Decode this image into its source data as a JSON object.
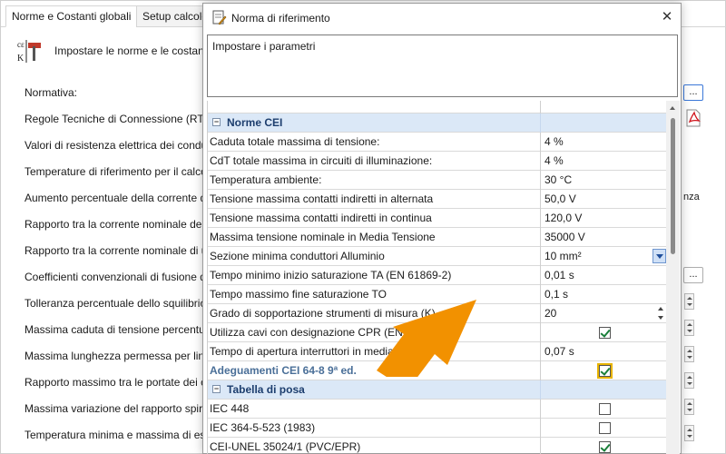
{
  "background": {
    "tabs": [
      "Norme e Costanti globali",
      "Setup calcolo"
    ],
    "header_text": "Impostare le norme e le costanti",
    "labels": [
      "Normativa:",
      "Regole Tecniche di Connessione (RTC):",
      "Valori di resistenza elettrica dei condutt",
      "Temperature di riferimento per il calcolo",
      "Aumento percentuale della corrente di",
      "Rapporto tra la corrente nominale dell",
      "Rapporto tra la corrente nominale di u",
      "Coefficienti convenzionali di fusione d",
      "Tolleranza percentuale dello squilibrio",
      "Massima caduta di tensione percentua",
      "Massima lunghezza permessa per line",
      "Rapporto massimo tra le portate dei c",
      "Massima variazione del rapporto spire",
      "Temperatura minima e massima di ese"
    ],
    "right_text": "nza",
    "dots_label": "..."
  },
  "dialog": {
    "title": "Norma di riferimento",
    "close_label": "✕",
    "description": "Impostare i parametri",
    "categories": {
      "norme": "Norme CEI",
      "tabella": "Tabella di posa"
    },
    "rows": [
      {
        "name": "Caduta totale massima di tensione:",
        "value": "4 %"
      },
      {
        "name": "CdT totale massima in circuiti di illuminazione:",
        "value": "4 %"
      },
      {
        "name": "Temperatura ambiente:",
        "value": "30 °C"
      },
      {
        "name": "Tensione massima contatti indiretti in alternata",
        "value": "50,0 V"
      },
      {
        "name": "Tensione massima contatti indiretti in continua",
        "value": "120,0 V"
      },
      {
        "name": "Massima tensione nominale in Media Tensione",
        "value": "35000 V"
      },
      {
        "name": "Sezione minima conduttori Alluminio",
        "value": "10 mm²"
      },
      {
        "name": "Tempo minimo inizio saturazione TA (EN 61869-2)",
        "value": "0,01 s"
      },
      {
        "name": "Tempo massimo fine saturazione TO",
        "value": "0,1 s"
      },
      {
        "name": "Grado di sopportazione strumenti di misura (K)",
        "value": "20"
      },
      {
        "name": "Utilizza cavi con designazione CPR (EN 5",
        "value": ""
      },
      {
        "name": "Tempo di apertura interruttori in media",
        "value": "0,07 s"
      },
      {
        "name": "Adeguamenti CEI 64-8 9ª ed.",
        "value": ""
      }
    ],
    "posa_rows": [
      {
        "name": "IEC 448"
      },
      {
        "name": "IEC 364-5-523 (1983)"
      },
      {
        "name": "CEI-UNEL 35024/1 (PVC/EPR)"
      }
    ],
    "checks": {
      "cpr": true,
      "adeguamenti": true,
      "iec448": false,
      "iec364": false,
      "cei_unel": true
    }
  },
  "colors": {
    "accent_orange": "#F29100",
    "category_bg": "#DBE8F7",
    "check_green": "#1A7F3A"
  }
}
